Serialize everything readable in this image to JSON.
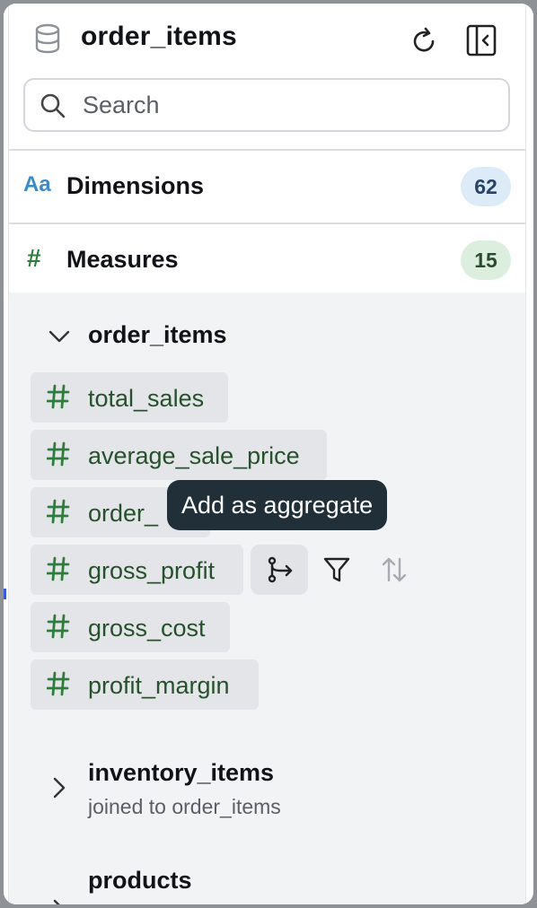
{
  "header": {
    "title": "order_items",
    "icons": {
      "database": "database-icon",
      "refresh": "refresh-icon",
      "collapse": "collapse-panel-icon"
    }
  },
  "search": {
    "placeholder": "Search",
    "value": ""
  },
  "sections": {
    "dimensions": {
      "icon_text": "Aa",
      "label": "Dimensions",
      "count": "62",
      "color": "#3d8bc4"
    },
    "measures": {
      "icon_text": "#",
      "label": "Measures",
      "count": "15",
      "color": "#2e7d3c"
    }
  },
  "groups": [
    {
      "name": "order_items",
      "expanded": true,
      "measures": [
        "total_sales",
        "average_sale_price",
        "order_",
        "gross_profit",
        "gross_cost",
        "profit_margin"
      ]
    },
    {
      "name": "inventory_items",
      "subtitle": "joined to order_items",
      "expanded": false
    },
    {
      "name": "products",
      "expanded": false
    }
  ],
  "hovered_actions": {
    "add_aggregate": "add-aggregate-icon",
    "filter": "filter-icon",
    "sort": "sort-icon"
  },
  "tooltip": {
    "text": "Add as aggregate"
  },
  "colors": {
    "chip_text": "#26512c",
    "tooltip_bg": "#213038",
    "body_bg": "#f1f3f5"
  }
}
